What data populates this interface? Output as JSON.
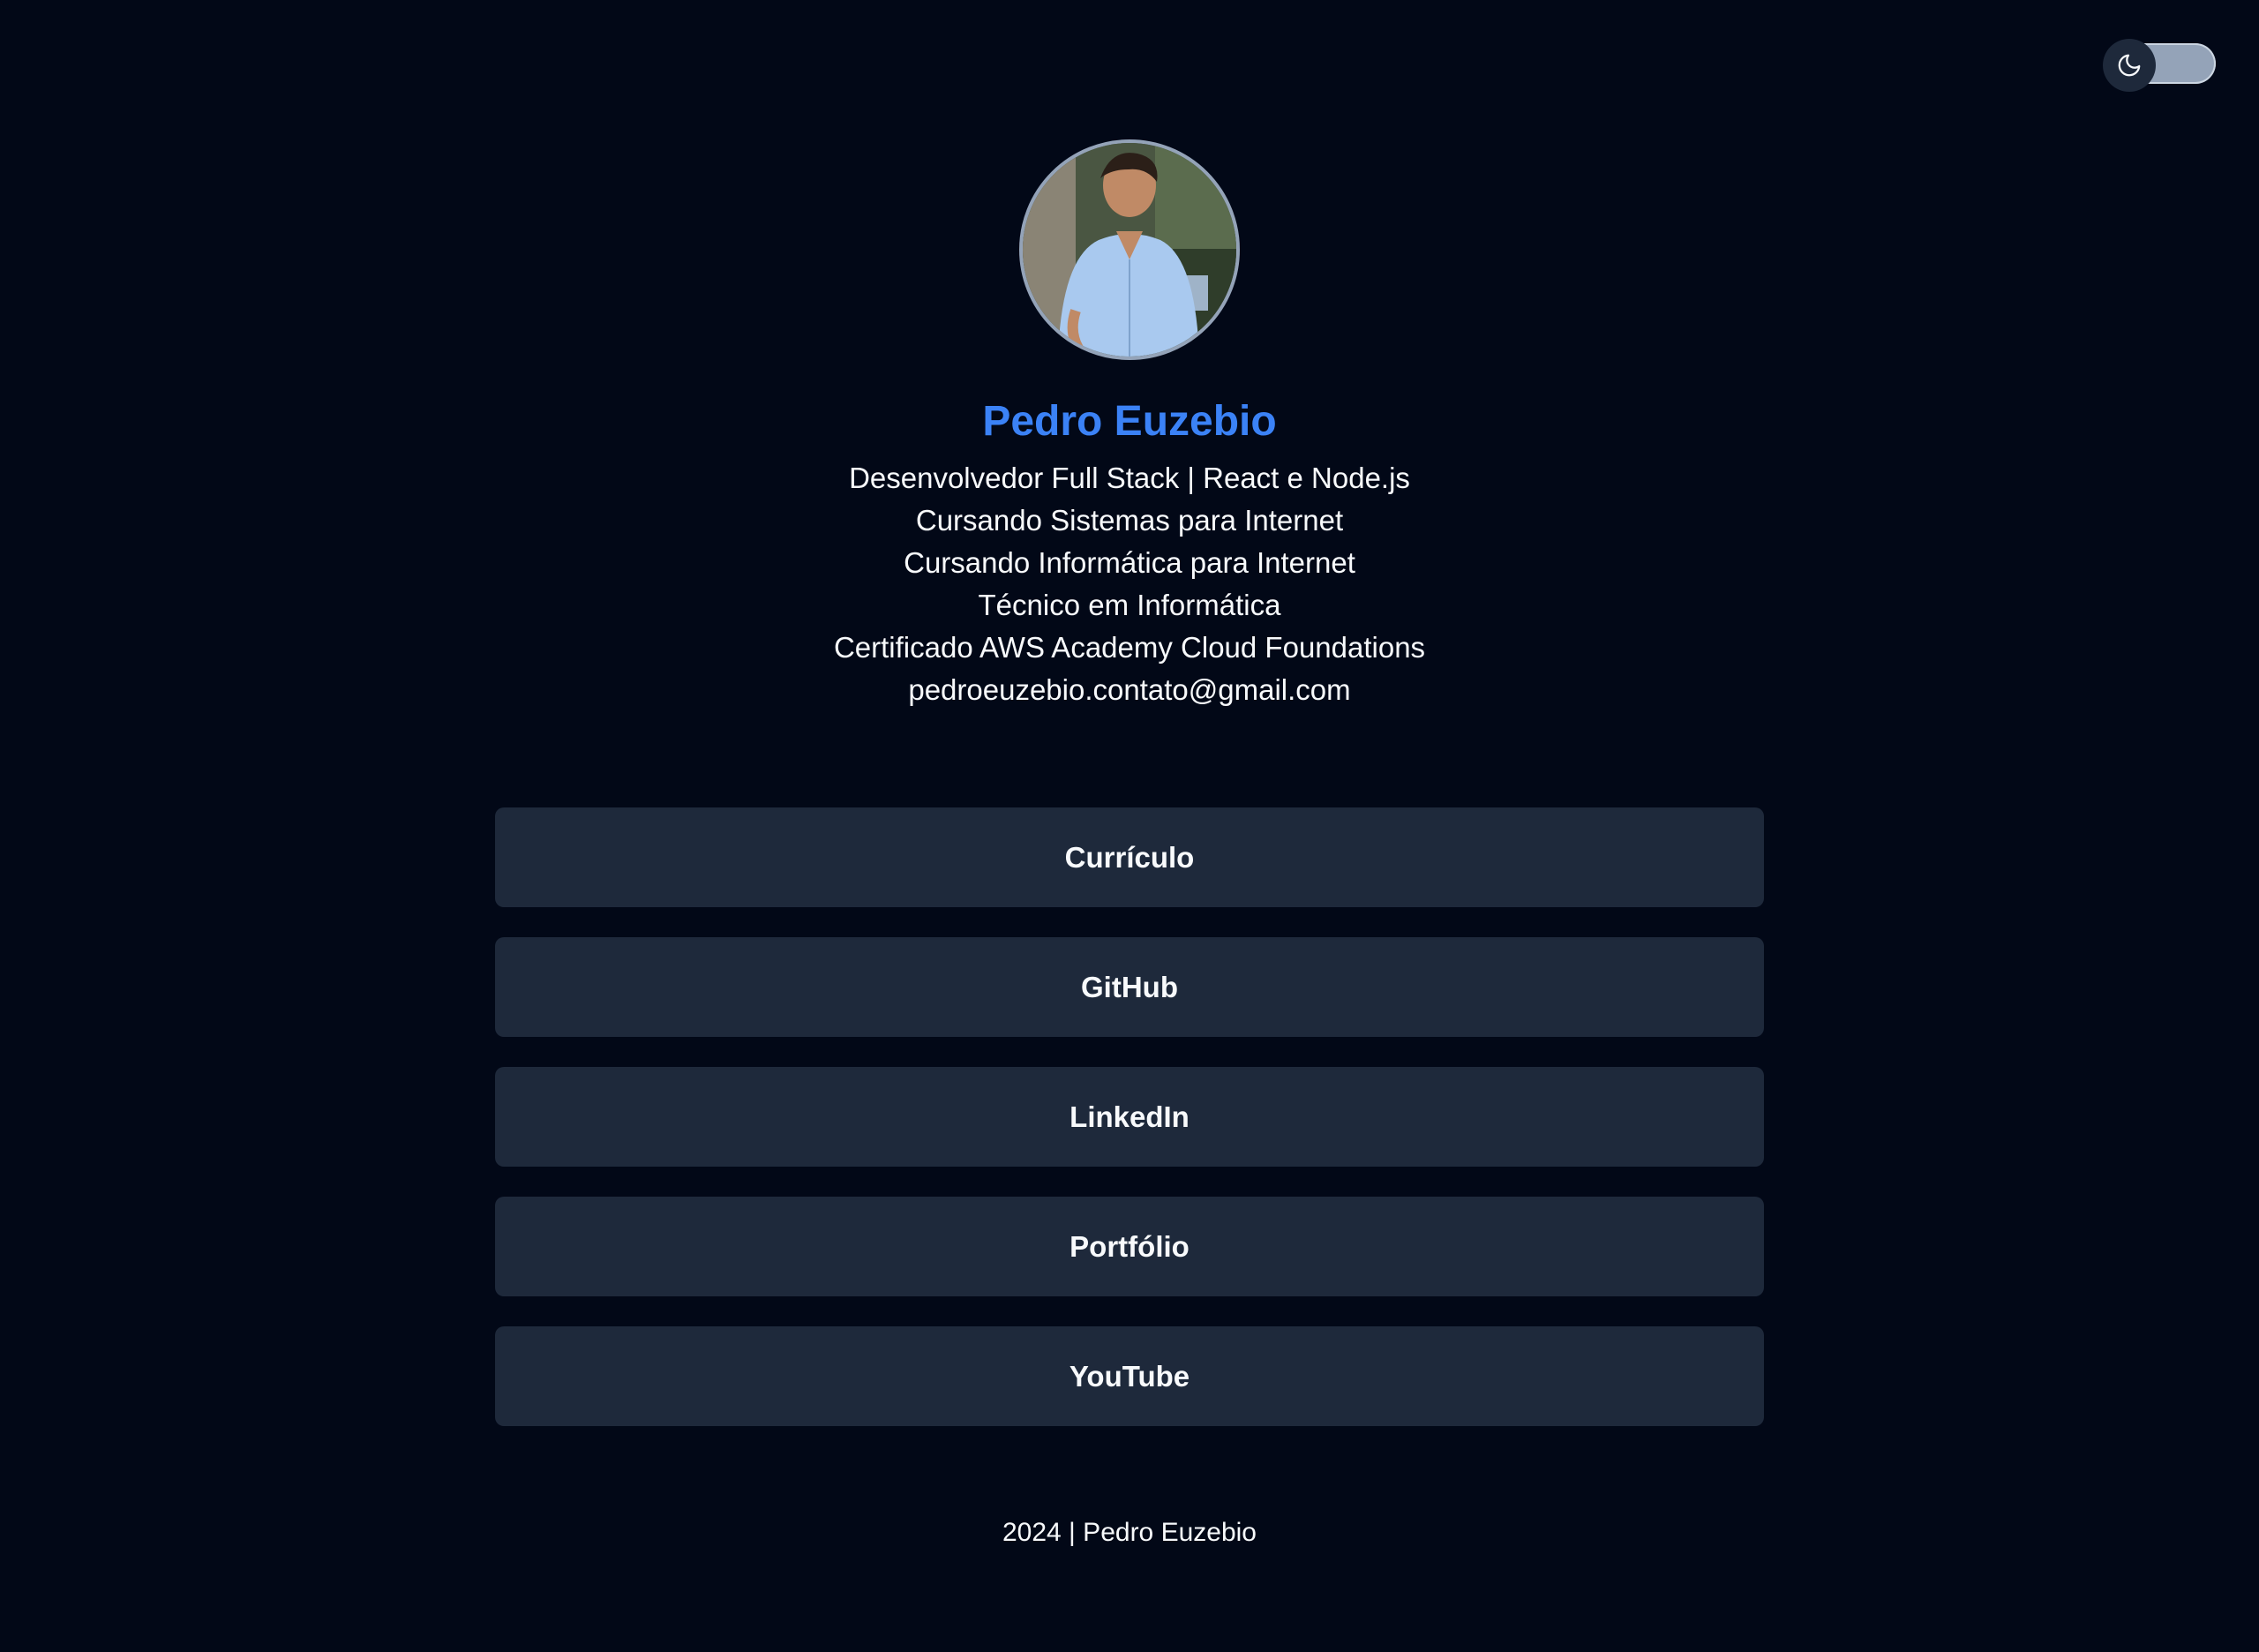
{
  "theme_toggle": {
    "icon": "moon-icon",
    "state": "dark"
  },
  "profile": {
    "avatar_alt": "",
    "name": "Pedro Euzebio",
    "bio": [
      "Desenvolvedor Full Stack | React e Node.js",
      "Cursando Sistemas para Internet",
      "Cursando Informática para Internet",
      "Técnico em Informática",
      "Certificado AWS Academy Cloud Foundations",
      "pedroeuzebio.contato@gmail.com"
    ]
  },
  "links": [
    {
      "label": "Currículo"
    },
    {
      "label": "GitHub"
    },
    {
      "label": "LinkedIn"
    },
    {
      "label": "Portfólio"
    },
    {
      "label": "YouTube"
    }
  ],
  "footer": {
    "text": "2024 | Pedro Euzebio"
  },
  "colors": {
    "background": "#020817",
    "accent": "#3b82f6",
    "button": "#1e293b",
    "text": "#f8fafc"
  }
}
